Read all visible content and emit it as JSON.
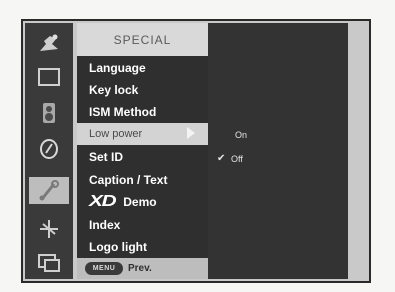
{
  "menu": {
    "title": "SPECIAL",
    "items": [
      {
        "label": "Language"
      },
      {
        "label": "Key lock"
      },
      {
        "label": "ISM Method"
      },
      {
        "label": "Low power"
      },
      {
        "label": "Set ID"
      },
      {
        "label": "Caption / Text"
      },
      {
        "label": "Demo",
        "logo_text": "XD"
      },
      {
        "label": "Index"
      },
      {
        "label": "Logo light"
      }
    ],
    "highlighted_index": 3
  },
  "footer": {
    "button_label": "MENU",
    "label": "Prev."
  },
  "submenu": {
    "options": [
      {
        "label": "On",
        "selected": false
      },
      {
        "label": "Off",
        "selected": true
      }
    ],
    "check_glyph": "✔"
  },
  "sidebar_icons": [
    {
      "name": "picture-icon"
    },
    {
      "name": "screen-icon"
    },
    {
      "name": "audio-icon"
    },
    {
      "name": "time-icon"
    },
    {
      "name": "special-icon",
      "active": true
    },
    {
      "name": "setup-icon"
    },
    {
      "name": "pip-icon"
    }
  ]
}
